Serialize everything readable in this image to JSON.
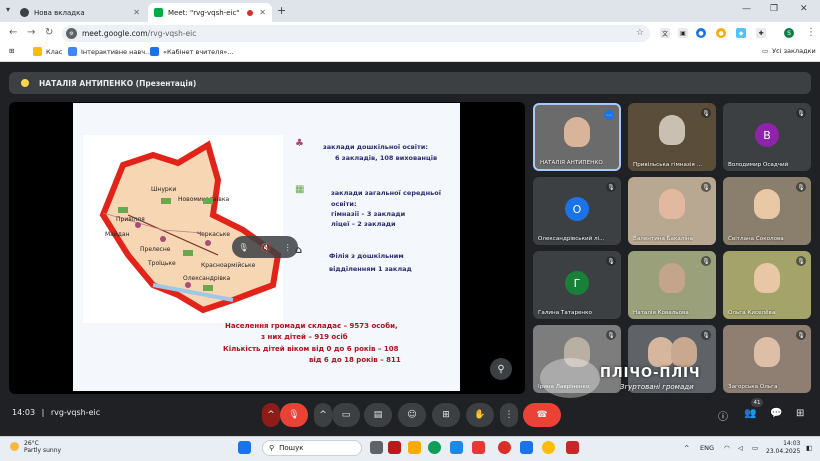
{
  "browser": {
    "tabs": [
      {
        "label": "Нова вкладка",
        "active": false
      },
      {
        "label": "Meet: \"rvg-vqsh-eic\"",
        "active": true
      }
    ],
    "url_host": "meet.google.com",
    "url_path": "/rvg-vqsh-eic",
    "profile_initial": "S",
    "bookmarks": [
      "Клас",
      "Інтерактивне навч...",
      "«Кабінет вчителя»..."
    ],
    "all_bookmarks": "Усі закладки"
  },
  "meet": {
    "presenter_label": "НАТАЛІЯ АНТИПЕНКО (Презентація)",
    "meeting_time": "14:03",
    "meeting_code": "rvg-vqsh-eic",
    "participants_count": "41",
    "slide": {
      "map_towns": [
        "Шнурки",
        "Новомиколаївка",
        "Привілля",
        "Майдан",
        "Черкаське",
        "Прелесне",
        "Троїцьке",
        "Олександрівка",
        "Красноармійське"
      ],
      "legend": [
        {
          "lines": [
            "заклади дошкільної освіти:",
            "6 закладів, 108 вихованців"
          ]
        },
        {
          "lines": [
            "заклади загальної середньої",
            "освіти:",
            "гімназії – 3 заклади",
            "ліцеї – 2 заклади"
          ]
        },
        {
          "lines": [
            "Філія з дошкільним",
            "відділенням      1 заклад"
          ]
        }
      ],
      "population": [
        "Населення громади складає –  9573 особи,",
        "з них  дітей – 919 осіб",
        "Кількість дітей  віком від 0 до 6 років – 108",
        "від 6 до 18 років – 811"
      ]
    },
    "participants": [
      {
        "name": "НАТАЛІЯ АНТИПЕНКО",
        "initial": "",
        "color": "#6b6b6b"
      },
      {
        "name": "Привільська гімназія ...",
        "initial": "",
        "color": "#5a4d3a"
      },
      {
        "name": "Володимир Осадчий",
        "initial": "В",
        "color": "#8e24aa"
      },
      {
        "name": "Олександрівський лі...",
        "initial": "О",
        "color": "#1a73e8"
      },
      {
        "name": "Валентина Бакаліна",
        "initial": "",
        "color": "#b8a892"
      },
      {
        "name": "Світлана Соколова",
        "initial": "",
        "color": "#8a7f6c"
      },
      {
        "name": "Галина Татаренко",
        "initial": "Г",
        "color": "#188038"
      },
      {
        "name": "Наталія Ковальова",
        "initial": "",
        "color": "#9aa07a"
      },
      {
        "name": "Ольга Киселёва",
        "initial": "",
        "color": "#a3a36a"
      },
      {
        "name": "Ірина Лавріненко",
        "initial": "",
        "color": "#7d7d7d"
      },
      {
        "name": "",
        "initial": "",
        "color": "#5f6368"
      },
      {
        "name": "Загорська Ольга",
        "initial": "",
        "color": "#8f7f72"
      }
    ],
    "watermark_title": "ПЛІЧО-ПЛІЧ",
    "watermark_subtitle": "Згуртовані громади"
  },
  "taskbar": {
    "weather_temp": "26°C",
    "weather_desc": "Partly sunny",
    "weather_badge": "1",
    "search_placeholder": "Пошук",
    "lang": "ENG",
    "time": "14:03",
    "date": "23.04.2025"
  },
  "colors": {
    "meet_bg": "#202124",
    "end_call_red": "#ea4335",
    "mic_off_red": "#8c1d18",
    "slide_text_blue": "#2b2b70",
    "slide_text_red": "#b0121b"
  }
}
